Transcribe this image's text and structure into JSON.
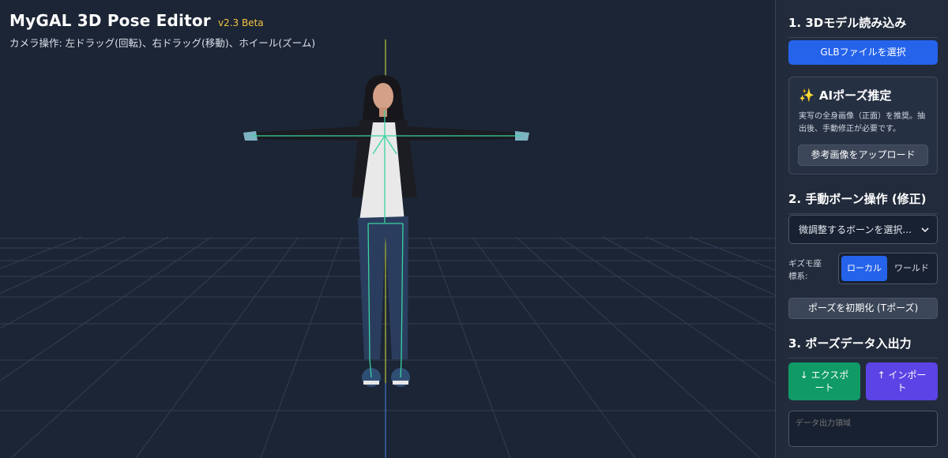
{
  "app": {
    "title": "MyGAL 3D Pose Editor",
    "version": "v2.3 Beta",
    "camera_hint": "カメラ操作: 左ドラッグ(回転)、右ドラッグ(移動)、ホイール(ズーム)"
  },
  "panel": {
    "section1": {
      "title": "1. 3Dモデル読み込み",
      "button": "GLBファイルを選択"
    },
    "ai": {
      "icon": "sparkles-icon",
      "title": "AIポーズ推定",
      "description": "実写の全身画像（正面）を推奨。抽出後、手動修正が必要です。",
      "button": "参考画像をアップロード"
    },
    "section2": {
      "title": "2. 手動ボーン操作 (修正)",
      "bone_select": "微調整するボーンを選択...",
      "gizmo_label": "ギズモ座標系:",
      "gizmo_local": "ローカル",
      "gizmo_world": "ワールド",
      "gizmo_selected": "ローカル",
      "reset_button": "ポーズを初期化 (Tポーズ)"
    },
    "section3": {
      "title": "3. ポーズデータ入出力",
      "export_button": "↓ エクスポート",
      "import_button": "↑ インポート",
      "output_placeholder": "データ出力領域"
    }
  },
  "colors": {
    "accent": "#2563eb",
    "version": "#f5c542",
    "export": "#0f9a66",
    "import": "#5b43e6"
  }
}
